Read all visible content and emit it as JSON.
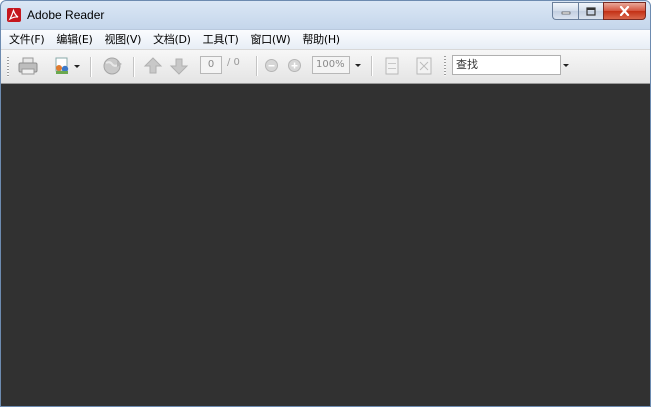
{
  "window": {
    "title": "Adobe Reader",
    "app_icon": "adobe-reader-icon"
  },
  "caption_buttons": {
    "minimize_icon": "minimize-icon",
    "maximize_icon": "maximize-icon",
    "close_icon": "close-icon"
  },
  "menu": {
    "items": [
      {
        "label": "文件(F)"
      },
      {
        "label": "编辑(E)"
      },
      {
        "label": "视图(V)"
      },
      {
        "label": "文档(D)"
      },
      {
        "label": "工具(T)"
      },
      {
        "label": "窗口(W)"
      },
      {
        "label": "帮助(H)"
      }
    ]
  },
  "toolbar": {
    "icons": [
      "print-icon",
      "collaborate-icon",
      "share-icon",
      "previous-page-icon",
      "next-page-icon",
      "zoom-out-icon",
      "zoom-in-icon",
      "fit-page-icon",
      "full-screen-icon"
    ],
    "page_number": "0",
    "page_total": "/ 0",
    "zoom_value": "100%",
    "search_placeholder": "查找"
  },
  "colors": {
    "document_background": "#313131",
    "title_bar": "#c3d5ea",
    "accent_red": "#c5161d"
  }
}
